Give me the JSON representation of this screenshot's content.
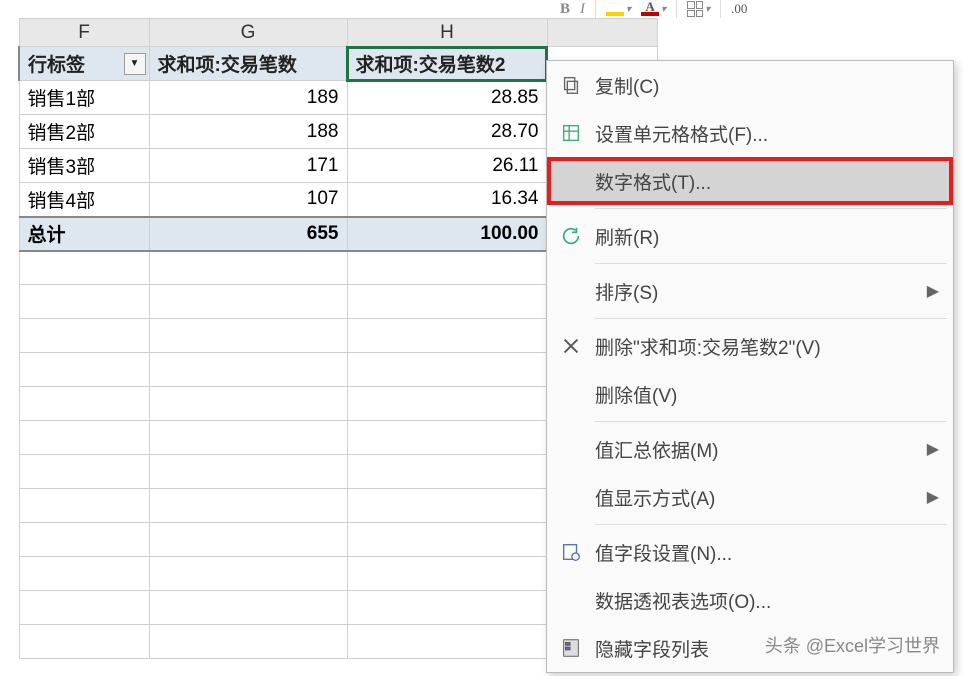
{
  "columns": {
    "f": "F",
    "g": "G",
    "h": "H"
  },
  "pivot": {
    "row_label_header": "行标签",
    "col_g_header": "求和项:交易笔数",
    "col_h_header": "求和项:交易笔数2",
    "rows": [
      {
        "label": "销售1部",
        "g": "189",
        "h": "28.85"
      },
      {
        "label": "销售2部",
        "g": "188",
        "h": "28.70"
      },
      {
        "label": "销售3部",
        "g": "171",
        "h": "26.11"
      },
      {
        "label": "销售4部",
        "g": "107",
        "h": "16.34"
      }
    ],
    "total_label": "总计",
    "total_g": "655",
    "total_h": "100.00"
  },
  "menu": {
    "copy": "复制(C)",
    "format_cells": "设置单元格格式(F)...",
    "number_format": "数字格式(T)...",
    "refresh": "刷新(R)",
    "sort": "排序(S)",
    "remove_field": "删除\"求和项:交易笔数2\"(V)",
    "remove_values": "删除值(V)",
    "summarize_by": "值汇总依据(M)",
    "show_values_as": "值显示方式(A)",
    "value_field_settings": "值字段设置(N)...",
    "pivot_options": "数据透视表选项(O)...",
    "hide_field_list": "隐藏字段列表"
  },
  "toolbar": {
    "bold": "B",
    "italic": "I",
    "font_a": "A",
    "decimals": ".00"
  },
  "watermark": "头条 @Excel学习世界"
}
